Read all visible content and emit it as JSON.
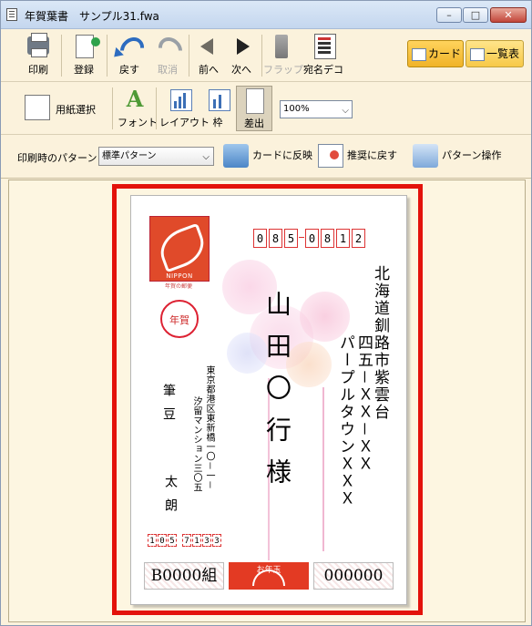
{
  "window": {
    "title": "年賀葉書　サンプル31.fwa",
    "buttons": {
      "minimize": "–",
      "maximize": "□",
      "close": "✕"
    }
  },
  "toolbar1": {
    "print": "印刷",
    "register": "登録",
    "undo": "戻す",
    "redo": "取消",
    "prev": "前へ",
    "next": "次へ",
    "flap": "フラップ",
    "address_deco": "宛名デコ",
    "view_card": "カード",
    "view_list": "一覧表"
  },
  "toolbar2": {
    "paper_select": "用紙選択",
    "font": "フォント",
    "layout": "レイアウト",
    "frame": "枠",
    "sender": "差出",
    "zoom": "100%"
  },
  "toolbar3": {
    "pattern_label": "印刷時のパターン",
    "pattern_value": "標準パターン",
    "reflect_to_card": "カードに反映",
    "restore_recommend": "推奨に戻す",
    "pattern_ops": "パターン操作"
  },
  "card": {
    "stamp_text": "NIPPON",
    "stamp_sub": "年賀の郵便",
    "nenga": "年賀",
    "zip_digits": [
      "0",
      "8",
      "5",
      "0",
      "8",
      "1",
      "2"
    ],
    "recipient_address_line1": "北海道釧路市紫雲台",
    "recipient_address_line2": "四五－ＸＸ－ＸＸ",
    "recipient_address_line3": "パープルタウンＸＸＸ",
    "recipient_name": "山田〇行様",
    "sender_address_line1": "東京都港区東新橋一〇－一－",
    "sender_address_line2": "汐留マンション三〇五",
    "sender_name_family": "筆豆",
    "sender_name_given": "太朗",
    "sender_zip_digits": [
      "1",
      "0",
      "5",
      "7",
      "1",
      "3",
      "3"
    ],
    "lottery_group": "B0000組",
    "lottery_label": "お年玉",
    "lottery_number": "000000"
  }
}
